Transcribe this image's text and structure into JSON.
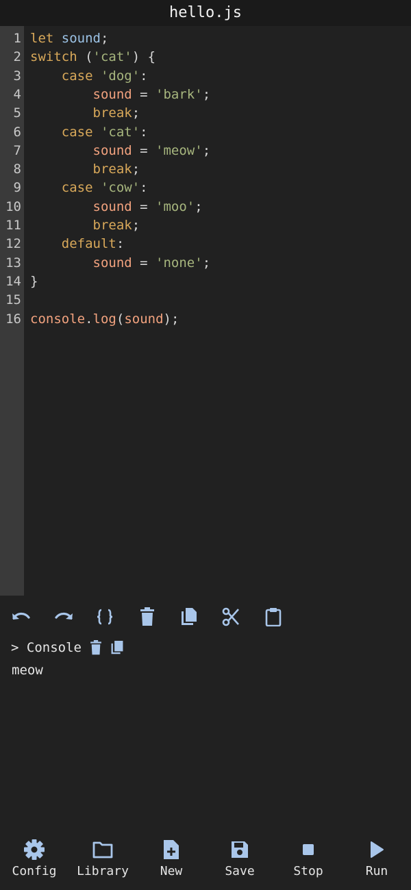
{
  "title": "hello.js",
  "colors": {
    "background": "#212121",
    "gutter": "#3a3a3a",
    "keyword": "#d9a95a",
    "variable": "#9cc3e6",
    "identifier": "#f3a37f",
    "string": "#a7b67e",
    "icon": "#a9c6ea"
  },
  "editor": {
    "line_numbers": [
      "1",
      "2",
      "3",
      "4",
      "5",
      "6",
      "7",
      "8",
      "9",
      "10",
      "11",
      "12",
      "13",
      "14",
      "15",
      "16"
    ],
    "lines": [
      [
        {
          "t": "let",
          "c": "kw"
        },
        {
          "t": " sound",
          "c": "var"
        },
        {
          "t": ";",
          "c": "punc"
        }
      ],
      [
        {
          "t": "switch",
          "c": "kw"
        },
        {
          "t": " (",
          "c": "punc"
        },
        {
          "t": "'cat'",
          "c": "str"
        },
        {
          "t": ") {",
          "c": "punc"
        }
      ],
      [
        {
          "t": "    case ",
          "c": "kw"
        },
        {
          "t": "'dog'",
          "c": "str"
        },
        {
          "t": ":",
          "c": "punc"
        }
      ],
      [
        {
          "t": "        sound",
          "c": "prop"
        },
        {
          "t": " = ",
          "c": "punc"
        },
        {
          "t": "'bark'",
          "c": "str"
        },
        {
          "t": ";",
          "c": "punc"
        }
      ],
      [
        {
          "t": "        break",
          "c": "kw"
        },
        {
          "t": ";",
          "c": "punc"
        }
      ],
      [
        {
          "t": "    case ",
          "c": "kw"
        },
        {
          "t": "'cat'",
          "c": "str"
        },
        {
          "t": ":",
          "c": "punc"
        }
      ],
      [
        {
          "t": "        sound",
          "c": "prop"
        },
        {
          "t": " = ",
          "c": "punc"
        },
        {
          "t": "'meow'",
          "c": "str"
        },
        {
          "t": ";",
          "c": "punc"
        }
      ],
      [
        {
          "t": "        break",
          "c": "kw"
        },
        {
          "t": ";",
          "c": "punc"
        }
      ],
      [
        {
          "t": "    case ",
          "c": "kw"
        },
        {
          "t": "'cow'",
          "c": "str"
        },
        {
          "t": ":",
          "c": "punc"
        }
      ],
      [
        {
          "t": "        sound",
          "c": "prop"
        },
        {
          "t": " = ",
          "c": "punc"
        },
        {
          "t": "'moo'",
          "c": "str"
        },
        {
          "t": ";",
          "c": "punc"
        }
      ],
      [
        {
          "t": "        break",
          "c": "kw"
        },
        {
          "t": ";",
          "c": "punc"
        }
      ],
      [
        {
          "t": "    default",
          "c": "kw"
        },
        {
          "t": ":",
          "c": "punc"
        }
      ],
      [
        {
          "t": "        sound",
          "c": "prop"
        },
        {
          "t": " = ",
          "c": "punc"
        },
        {
          "t": "'none'",
          "c": "str"
        },
        {
          "t": ";",
          "c": "punc"
        }
      ],
      [
        {
          "t": "}",
          "c": "punc"
        }
      ],
      [],
      [
        {
          "t": "console",
          "c": "prop"
        },
        {
          "t": ".",
          "c": "punc"
        },
        {
          "t": "log",
          "c": "prop"
        },
        {
          "t": "(",
          "c": "punc"
        },
        {
          "t": "sound",
          "c": "prop"
        },
        {
          "t": ");",
          "c": "punc"
        }
      ]
    ]
  },
  "toolbar": {
    "icons": [
      "undo-icon",
      "redo-icon",
      "format-braces-icon",
      "delete-icon",
      "copy-icon",
      "cut-icon",
      "paste-icon"
    ]
  },
  "console": {
    "label": "> Console",
    "output": "meow"
  },
  "bottom_nav": {
    "config": "Config",
    "library": "Library",
    "new": "New",
    "save": "Save",
    "stop": "Stop",
    "run": "Run"
  }
}
